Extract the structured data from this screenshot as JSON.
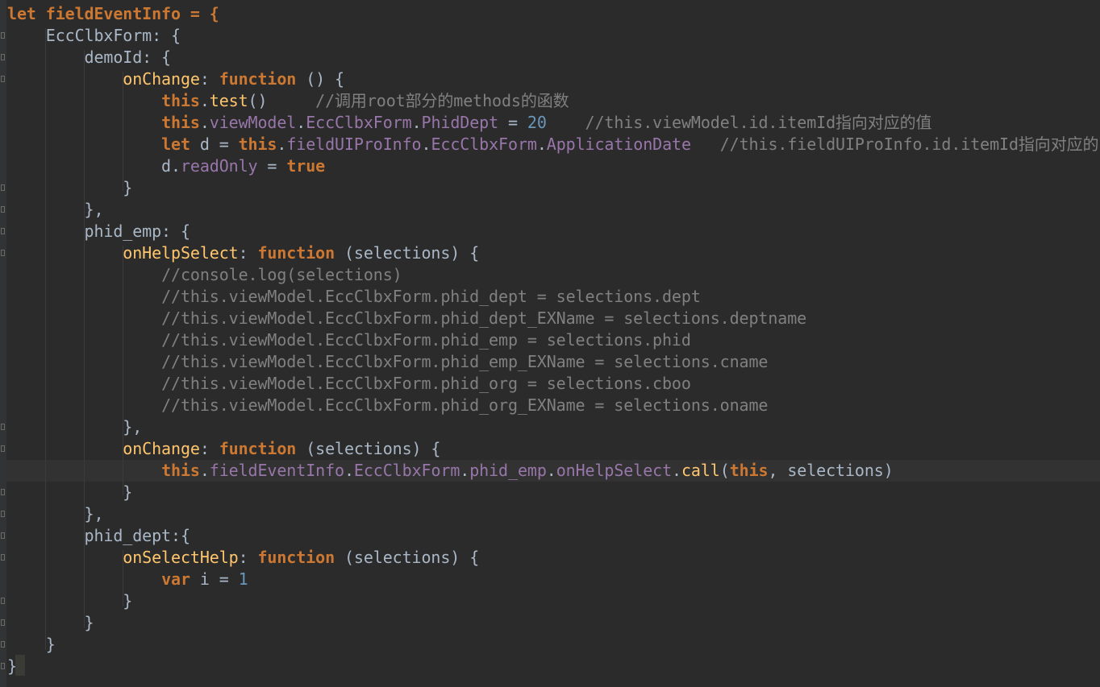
{
  "editor": {
    "language": "javascript",
    "theme": "darcula",
    "caret_line": 22,
    "lines": [
      "let fieldEventInfo = {",
      "    EccClbxForm: {",
      "        demoId: {",
      "            onChange: function () {",
      "                this.test()     //调用root部分的methods的函数",
      "                this.viewModel.EccClbxForm.PhidDept = 20    //this.viewModel.id.itemId指向对应的值",
      "                let d = this.fieldUIProInfo.EccClbxForm.ApplicationDate   //this.fieldUIProInfo.id.itemId指向对应的",
      "                d.readOnly = true",
      "            }",
      "        },",
      "        phid_emp: {",
      "            onHelpSelect: function (selections) {",
      "                //console.log(selections)",
      "                //this.viewModel.EccClbxForm.phid_dept = selections.dept",
      "                //this.viewModel.EccClbxForm.phid_dept_EXName = selections.deptname",
      "                //this.viewModel.EccClbxForm.phid_emp = selections.phid",
      "                //this.viewModel.EccClbxForm.phid_emp_EXName = selections.cname",
      "                //this.viewModel.EccClbxForm.phid_org = selections.cboo",
      "                //this.viewModel.EccClbxForm.phid_org_EXName = selections.oname",
      "            },",
      "            onChange: function (selections) {",
      "                this.fieldEventInfo.EccClbxForm.phid_emp.onHelpSelect.call(this, selections)",
      "            }",
      "        },",
      "        phid_dept:{",
      "            onSelectHelp: function (selections) {",
      "                var i = 1",
      "            }",
      "        }",
      "    }",
      "}"
    ]
  }
}
